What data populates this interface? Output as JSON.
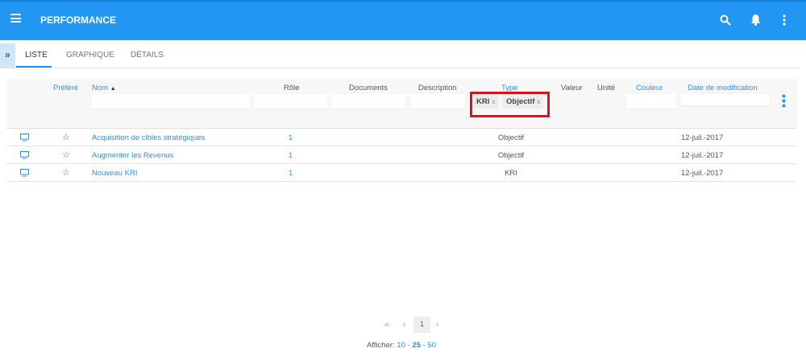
{
  "header": {
    "title": "PERFORMANCE"
  },
  "tabs": [
    {
      "label": "LISTE"
    },
    {
      "label": "GRAPHIQUE"
    },
    {
      "label": "DÉTAILS"
    }
  ],
  "columns": {
    "prefere": "Préféré",
    "nom": "Nom",
    "role": "Rôle",
    "documents": "Documents",
    "description": "Description",
    "type": "Type",
    "valeur": "Valeur",
    "unite": "Unité",
    "couleur": "Couleur",
    "date": "Date de modification"
  },
  "type_filter": [
    "KRI",
    "Objectif"
  ],
  "rows": [
    {
      "nom": "Acquisition de cibles stratégiques",
      "role": "1",
      "type": "Objectif",
      "date": "12-juil.-2017"
    },
    {
      "nom": "Augmenter les Revenus",
      "role": "1",
      "type": "Objectif",
      "date": "12-juil.-2017"
    },
    {
      "nom": "Nouveau KRI",
      "role": "1",
      "type": "KRI",
      "date": "12-juil.-2017"
    }
  ],
  "pagination": {
    "page": "1",
    "show_label": "Afficher:",
    "sizes": [
      "10",
      "25",
      "50"
    ],
    "selected": "25"
  }
}
